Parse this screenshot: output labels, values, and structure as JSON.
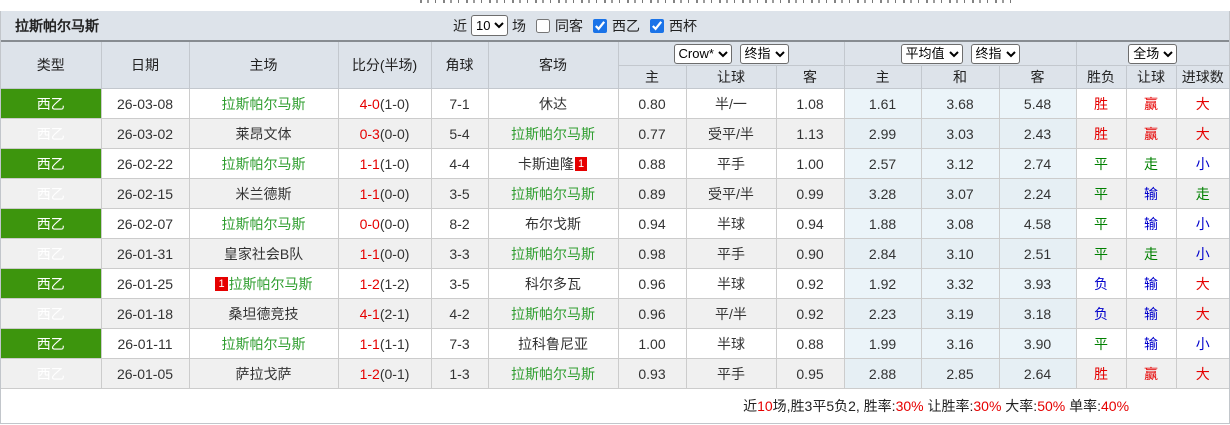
{
  "title": "拉斯帕尔马斯",
  "filterbar": {
    "near_label": "近",
    "count_value": "10",
    "unit_label": "场",
    "same_away_label": "同客",
    "same_away_checked": false,
    "league_label": "西乙",
    "league_checked": true,
    "cup_label": "西杯",
    "cup_checked": true
  },
  "header": {
    "type": "类型",
    "date": "日期",
    "home": "主场",
    "score": "比分(半场)",
    "corner": "角球",
    "away": "客场",
    "sel_company": "Crow*",
    "sel_final1": "终指",
    "sel_avg": "平均值",
    "sel_final2": "终指",
    "sel_scope": "全场",
    "sub": [
      "主",
      "让球",
      "客",
      "主",
      "和",
      "客",
      "胜负",
      "让球",
      "进球数"
    ]
  },
  "rows": [
    {
      "type": "西乙",
      "date": "26-03-08",
      "home": "拉斯帕尔马斯",
      "home_main": true,
      "home_badge": "",
      "score": "4-0",
      "half": "(1-0)",
      "corner": "7-1",
      "away": "休达",
      "away_main": false,
      "away_badge": "",
      "o1": "0.80",
      "hcap": "半/一",
      "o2": "1.08",
      "a1": "1.61",
      "a2": "3.68",
      "a3": "5.48",
      "res": "胜",
      "res_c": "red",
      "hres": "赢",
      "hres_c": "red",
      "gres": "大",
      "gres_c": "red"
    },
    {
      "type": "西乙",
      "date": "26-03-02",
      "home": "莱昂文体",
      "home_main": false,
      "home_badge": "",
      "score": "0-3",
      "half": "(0-0)",
      "corner": "5-4",
      "away": "拉斯帕尔马斯",
      "away_main": true,
      "away_badge": "",
      "o1": "0.77",
      "hcap": "受平/半",
      "o2": "1.13",
      "a1": "2.99",
      "a2": "3.03",
      "a3": "2.43",
      "res": "胜",
      "res_c": "red",
      "hres": "赢",
      "hres_c": "red",
      "gres": "大",
      "gres_c": "red"
    },
    {
      "type": "西乙",
      "date": "26-02-22",
      "home": "拉斯帕尔马斯",
      "home_main": true,
      "home_badge": "",
      "score": "1-1",
      "half": "(1-0)",
      "corner": "4-4",
      "away": "卡斯迪隆",
      "away_main": false,
      "away_badge": "1",
      "o1": "0.88",
      "hcap": "平手",
      "o2": "1.00",
      "a1": "2.57",
      "a2": "3.12",
      "a3": "2.74",
      "res": "平",
      "res_c": "green",
      "hres": "走",
      "hres_c": "green",
      "gres": "小",
      "gres_c": "blue"
    },
    {
      "type": "西乙",
      "date": "26-02-15",
      "home": "米兰德斯",
      "home_main": false,
      "home_badge": "",
      "score": "1-1",
      "half": "(0-0)",
      "corner": "3-5",
      "away": "拉斯帕尔马斯",
      "away_main": true,
      "away_badge": "",
      "o1": "0.89",
      "hcap": "受平/半",
      "o2": "0.99",
      "a1": "3.28",
      "a2": "3.07",
      "a3": "2.24",
      "res": "平",
      "res_c": "green",
      "hres": "输",
      "hres_c": "blue",
      "gres": "走",
      "gres_c": "green"
    },
    {
      "type": "西乙",
      "date": "26-02-07",
      "home": "拉斯帕尔马斯",
      "home_main": true,
      "home_badge": "",
      "score": "0-0",
      "half": "(0-0)",
      "corner": "8-2",
      "away": "布尔戈斯",
      "away_main": false,
      "away_badge": "",
      "o1": "0.94",
      "hcap": "半球",
      "o2": "0.94",
      "a1": "1.88",
      "a2": "3.08",
      "a3": "4.58",
      "res": "平",
      "res_c": "green",
      "hres": "输",
      "hres_c": "blue",
      "gres": "小",
      "gres_c": "blue"
    },
    {
      "type": "西乙",
      "date": "26-01-31",
      "home": "皇家社会B队",
      "home_main": false,
      "home_badge": "",
      "score": "1-1",
      "half": "(0-0)",
      "corner": "3-3",
      "away": "拉斯帕尔马斯",
      "away_main": true,
      "away_badge": "",
      "o1": "0.98",
      "hcap": "平手",
      "o2": "0.90",
      "a1": "2.84",
      "a2": "3.10",
      "a3": "2.51",
      "res": "平",
      "res_c": "green",
      "hres": "走",
      "hres_c": "green",
      "gres": "小",
      "gres_c": "blue"
    },
    {
      "type": "西乙",
      "date": "26-01-25",
      "home": "拉斯帕尔马斯",
      "home_main": true,
      "home_badge": "1",
      "score": "1-2",
      "half": "(1-2)",
      "corner": "3-5",
      "away": "科尔多瓦",
      "away_main": false,
      "away_badge": "",
      "o1": "0.96",
      "hcap": "半球",
      "o2": "0.92",
      "a1": "1.92",
      "a2": "3.32",
      "a3": "3.93",
      "res": "负",
      "res_c": "blue",
      "hres": "输",
      "hres_c": "blue",
      "gres": "大",
      "gres_c": "red"
    },
    {
      "type": "西乙",
      "date": "26-01-18",
      "home": "桑坦德竞技",
      "home_main": false,
      "home_badge": "",
      "score": "4-1",
      "half": "(2-1)",
      "corner": "4-2",
      "away": "拉斯帕尔马斯",
      "away_main": true,
      "away_badge": "",
      "o1": "0.96",
      "hcap": "平/半",
      "o2": "0.92",
      "a1": "2.23",
      "a2": "3.19",
      "a3": "3.18",
      "res": "负",
      "res_c": "blue",
      "hres": "输",
      "hres_c": "blue",
      "gres": "大",
      "gres_c": "red"
    },
    {
      "type": "西乙",
      "date": "26-01-11",
      "home": "拉斯帕尔马斯",
      "home_main": true,
      "home_badge": "",
      "score": "1-1",
      "half": "(1-1)",
      "corner": "7-3",
      "away": "拉科鲁尼亚",
      "away_main": false,
      "away_badge": "",
      "o1": "1.00",
      "hcap": "半球",
      "o2": "0.88",
      "a1": "1.99",
      "a2": "3.16",
      "a3": "3.90",
      "res": "平",
      "res_c": "green",
      "hres": "输",
      "hres_c": "blue",
      "gres": "小",
      "gres_c": "blue"
    },
    {
      "type": "西乙",
      "date": "26-01-05",
      "home": "萨拉戈萨",
      "home_main": false,
      "home_badge": "",
      "score": "1-2",
      "half": "(0-1)",
      "corner": "1-3",
      "away": "拉斯帕尔马斯",
      "away_main": true,
      "away_badge": "",
      "o1": "0.93",
      "hcap": "平手",
      "o2": "0.95",
      "a1": "2.88",
      "a2": "2.85",
      "a3": "2.64",
      "res": "胜",
      "res_c": "red",
      "hres": "赢",
      "hres_c": "red",
      "gres": "大",
      "gres_c": "red"
    }
  ],
  "footer": {
    "segments": [
      {
        "text": "近",
        "red": false
      },
      {
        "text": "10",
        "red": true
      },
      {
        "text": "场,胜3平5负2, 胜率:",
        "red": false
      },
      {
        "text": "30%",
        "red": true
      },
      {
        "text": " 让胜率:",
        "red": false
      },
      {
        "text": "30%",
        "red": true
      },
      {
        "text": " 大率:",
        "red": false
      },
      {
        "text": "50%",
        "red": true
      },
      {
        "text": " 单率:",
        "red": false
      },
      {
        "text": "40%",
        "red": true
      }
    ]
  }
}
